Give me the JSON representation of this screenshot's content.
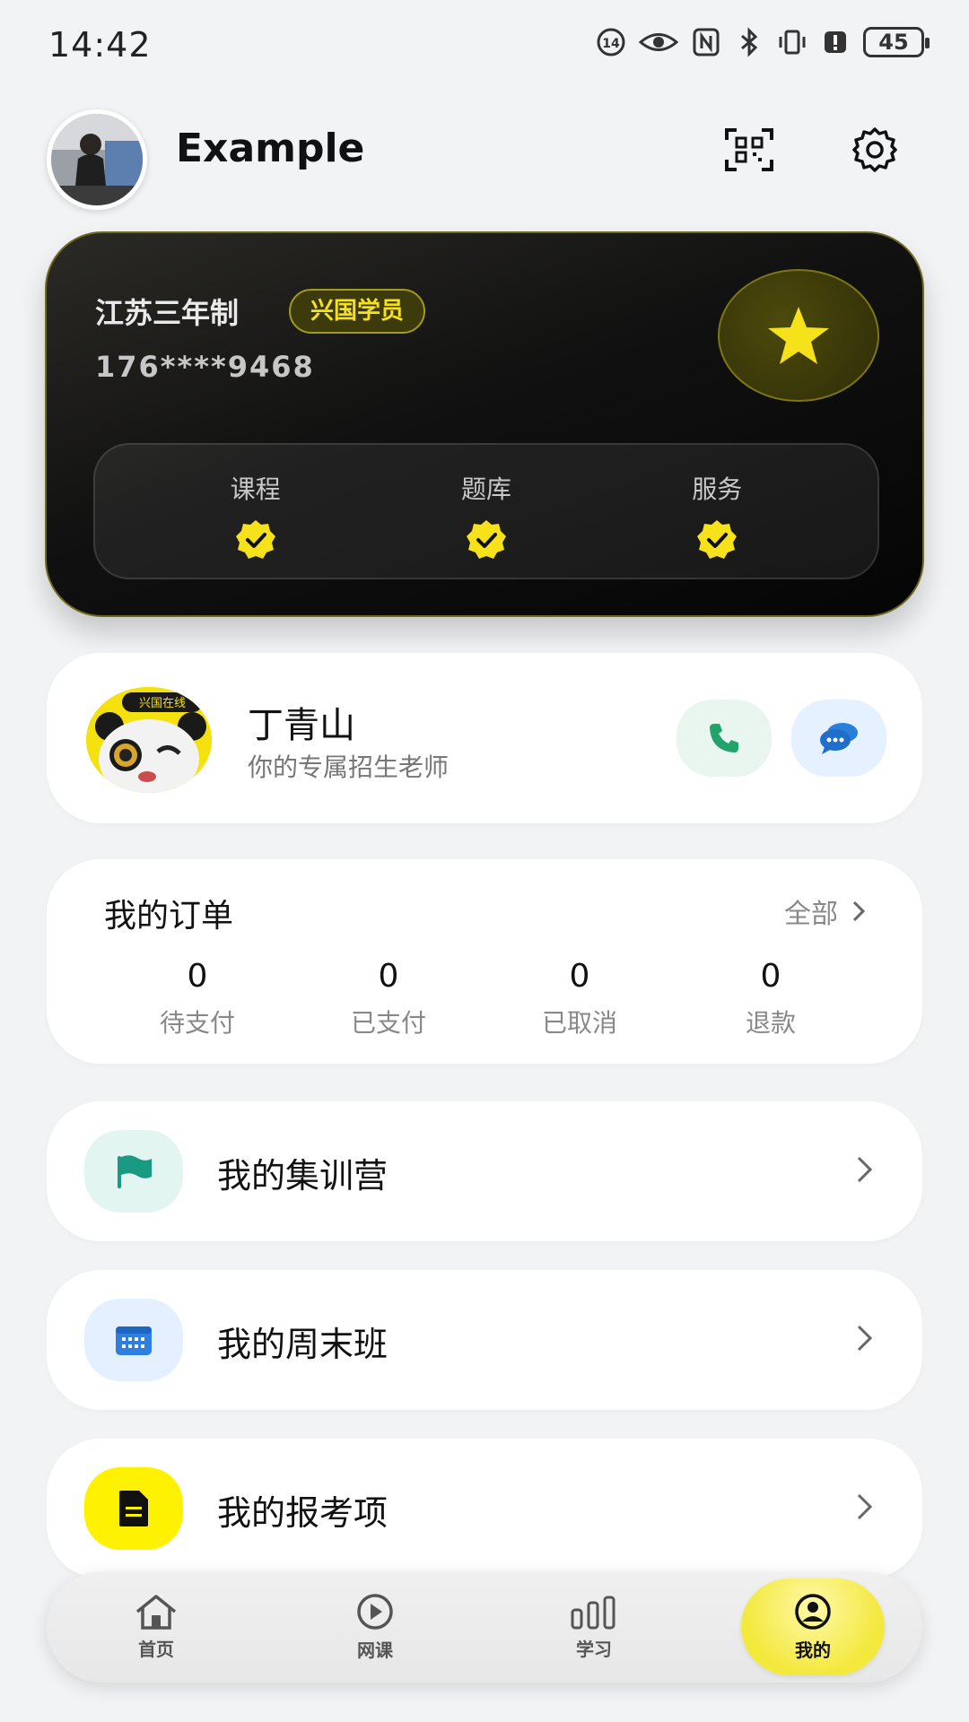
{
  "status_bar": {
    "time": "14:42",
    "battery": "45"
  },
  "header": {
    "username": "Example"
  },
  "member_card": {
    "title": "江苏三年制",
    "badge": "兴国学员",
    "phone": "176****9468",
    "benefits": [
      {
        "label": "课程"
      },
      {
        "label": "题库"
      },
      {
        "label": "服务"
      }
    ]
  },
  "teacher": {
    "name": "丁青山",
    "description": "你的专属招生老师",
    "avatar_text": "兴国在线"
  },
  "orders": {
    "title": "我的订单",
    "all_label": "全部",
    "stats": [
      {
        "value": "0",
        "label": "待支付"
      },
      {
        "value": "0",
        "label": "已支付"
      },
      {
        "value": "0",
        "label": "已取消"
      },
      {
        "value": "0",
        "label": "退款"
      }
    ]
  },
  "menu": [
    {
      "label": "我的集训营",
      "icon": "flag-icon",
      "color": "#1a9a83",
      "bg": "#e3f5f1"
    },
    {
      "label": "我的周末班",
      "icon": "calendar-icon",
      "color": "#2f7fe0",
      "bg": "#e4f0ff"
    },
    {
      "label": "我的报考项",
      "icon": "document-icon",
      "color": "#111111",
      "bg": "#fff200"
    }
  ],
  "bottom_nav": [
    {
      "label": "首页",
      "icon": "home-icon"
    },
    {
      "label": "网课",
      "icon": "play-icon"
    },
    {
      "label": "学习",
      "icon": "bars-icon"
    },
    {
      "label": "我的",
      "icon": "profile-icon",
      "active": true
    }
  ],
  "colors": {
    "accent_yellow": "#f6e21a",
    "background": "#f2f3f5",
    "card_dark": "#0b0b0b"
  }
}
